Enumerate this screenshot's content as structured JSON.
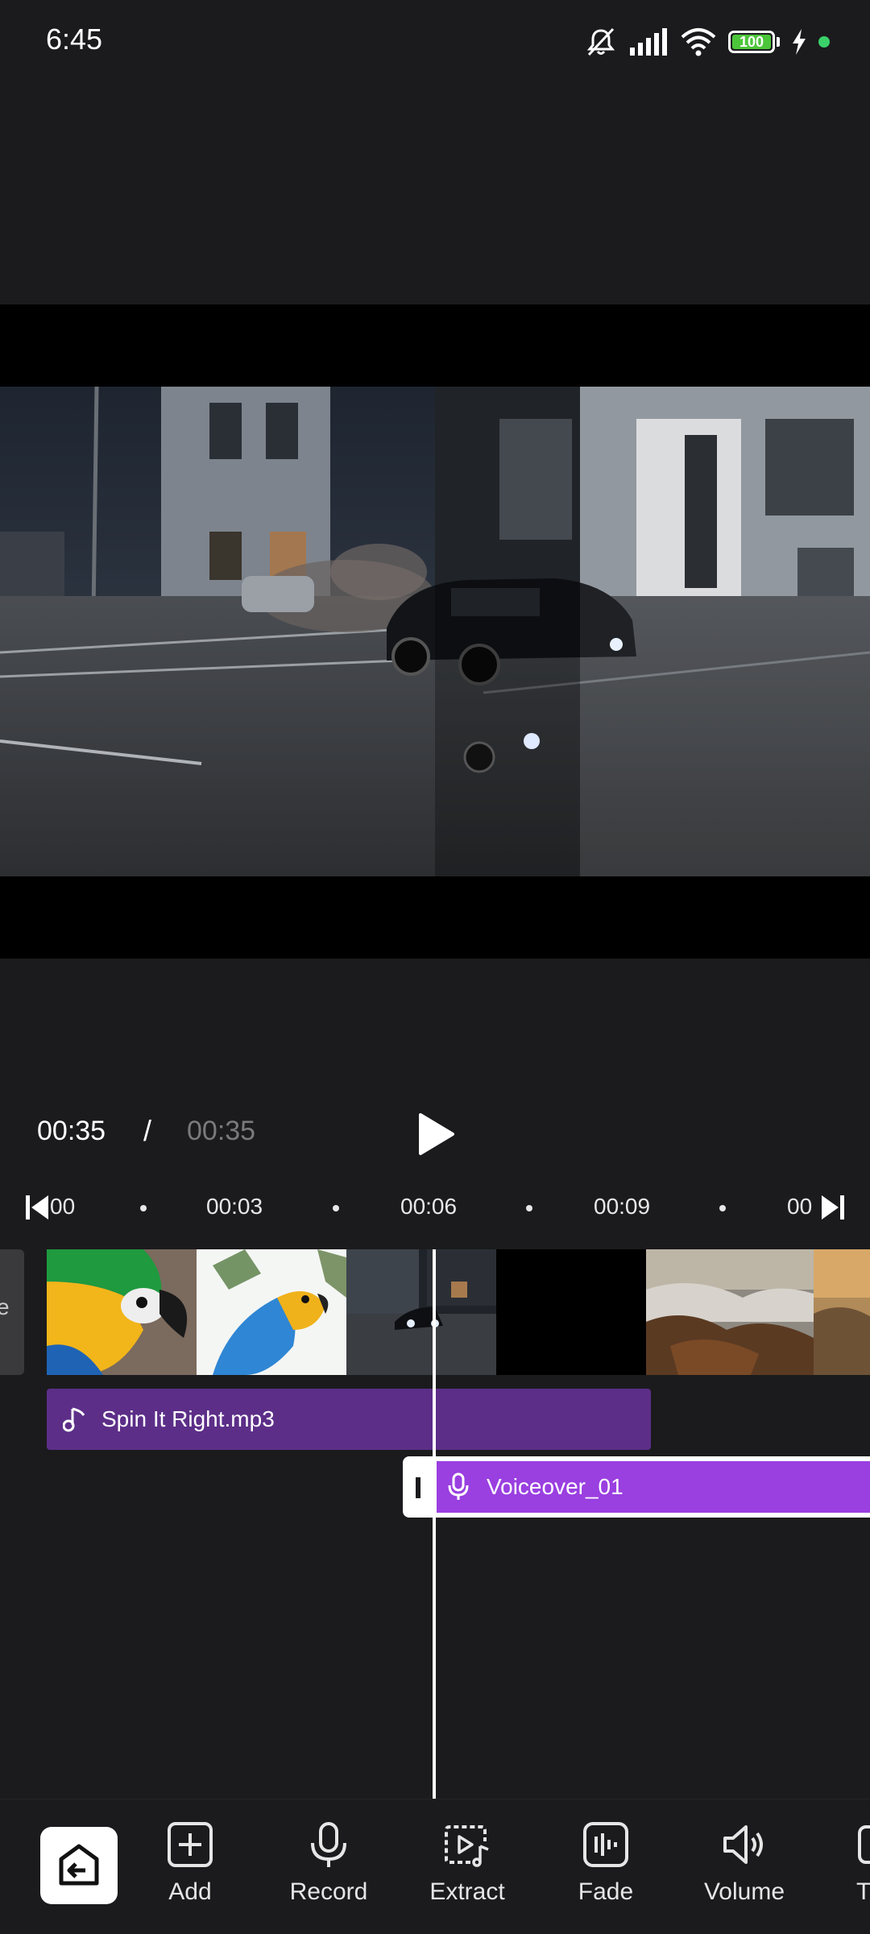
{
  "status_bar": {
    "time": "6:45",
    "battery": "100"
  },
  "player": {
    "current_time": "00:35",
    "separator": "/",
    "total_time": "00:35"
  },
  "ruler": {
    "start_label": "00",
    "marks": [
      "00:03",
      "00:06",
      "00:09"
    ],
    "end_label": "00"
  },
  "timeline": {
    "prev_clip_label": "e",
    "music_track": "Spin It Right.mp3",
    "voice_track": "Voiceover_01"
  },
  "toolbar": {
    "items": [
      {
        "label": "Add",
        "icon": "plus-square-icon"
      },
      {
        "label": "Record",
        "icon": "microphone-icon"
      },
      {
        "label": "Extract",
        "icon": "extract-audio-icon"
      },
      {
        "label": "Fade",
        "icon": "fade-icon"
      },
      {
        "label": "Volume",
        "icon": "volume-icon"
      },
      {
        "label": "T",
        "icon": "more-tool-icon"
      }
    ]
  },
  "colors": {
    "music_track": "#5c2e88",
    "voice_track": "#9a3fe0",
    "background": "#1b1b1d"
  }
}
